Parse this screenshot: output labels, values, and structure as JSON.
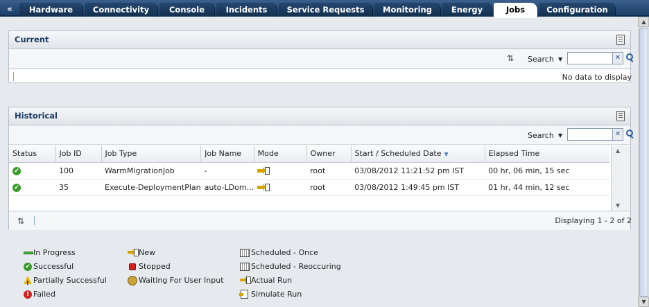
{
  "tabs": [
    {
      "label": "Hardware",
      "active": false
    },
    {
      "label": "Connectivity",
      "active": false
    },
    {
      "label": "Console",
      "active": false
    },
    {
      "label": "Incidents",
      "active": false
    },
    {
      "label": "Service Requests",
      "active": false
    },
    {
      "label": "Monitoring",
      "active": false
    },
    {
      "label": "Energy",
      "active": false
    },
    {
      "label": "Jobs",
      "active": true
    },
    {
      "label": "Configuration",
      "active": false
    }
  ],
  "tab_back_glyph": "«",
  "current": {
    "title": "Current",
    "search_label": "Search",
    "search_value": "",
    "no_data": "No data to display"
  },
  "historical": {
    "title": "Historical",
    "search_label": "Search",
    "search_value": "",
    "columns": [
      "Status",
      "Job ID",
      "Job Type",
      "Job Name",
      "Mode",
      "Owner",
      "Start / Scheduled Date",
      "Elapsed Time"
    ],
    "sorted_column": "Start / Scheduled Date",
    "rows": [
      {
        "status": "successful",
        "job_id": "100",
        "job_type": "WarmMigrationJob",
        "job_name": "-",
        "mode": "actual-run",
        "owner": "root",
        "start": "03/08/2012 11:21:52 pm IST",
        "elapsed": "00 hr, 06 min, 15 sec"
      },
      {
        "status": "successful",
        "job_id": "35",
        "job_type": "Execute-DeploymentPlan",
        "job_name": "auto-LDom...",
        "mode": "actual-run",
        "owner": "root",
        "start": "03/08/2012 1:49:45 pm IST",
        "elapsed": "01 hr, 44 min, 12 sec"
      }
    ],
    "displaying": "Displaying 1 - 2 of 2"
  },
  "legend": {
    "status": [
      {
        "icon": "in-progress-icon",
        "label": "In Progress"
      },
      {
        "icon": "successful-icon",
        "label": "Successful"
      },
      {
        "icon": "partially-successful-icon",
        "label": "Partially Successful"
      },
      {
        "icon": "failed-icon",
        "label": "Failed"
      }
    ],
    "state": [
      {
        "icon": "new-icon",
        "label": "New"
      },
      {
        "icon": "stopped-icon",
        "label": "Stopped"
      },
      {
        "icon": "waiting-for-user-input-icon",
        "label": "Waiting For User Input"
      }
    ],
    "mode": [
      {
        "icon": "scheduled-once-icon",
        "label": "Scheduled - Once"
      },
      {
        "icon": "scheduled-reoccuring-icon",
        "label": "Scheduled - Reoccuring"
      },
      {
        "icon": "actual-run-icon",
        "label": "Actual Run"
      },
      {
        "icon": "simulate-run-icon",
        "label": "Simulate Run"
      }
    ]
  }
}
